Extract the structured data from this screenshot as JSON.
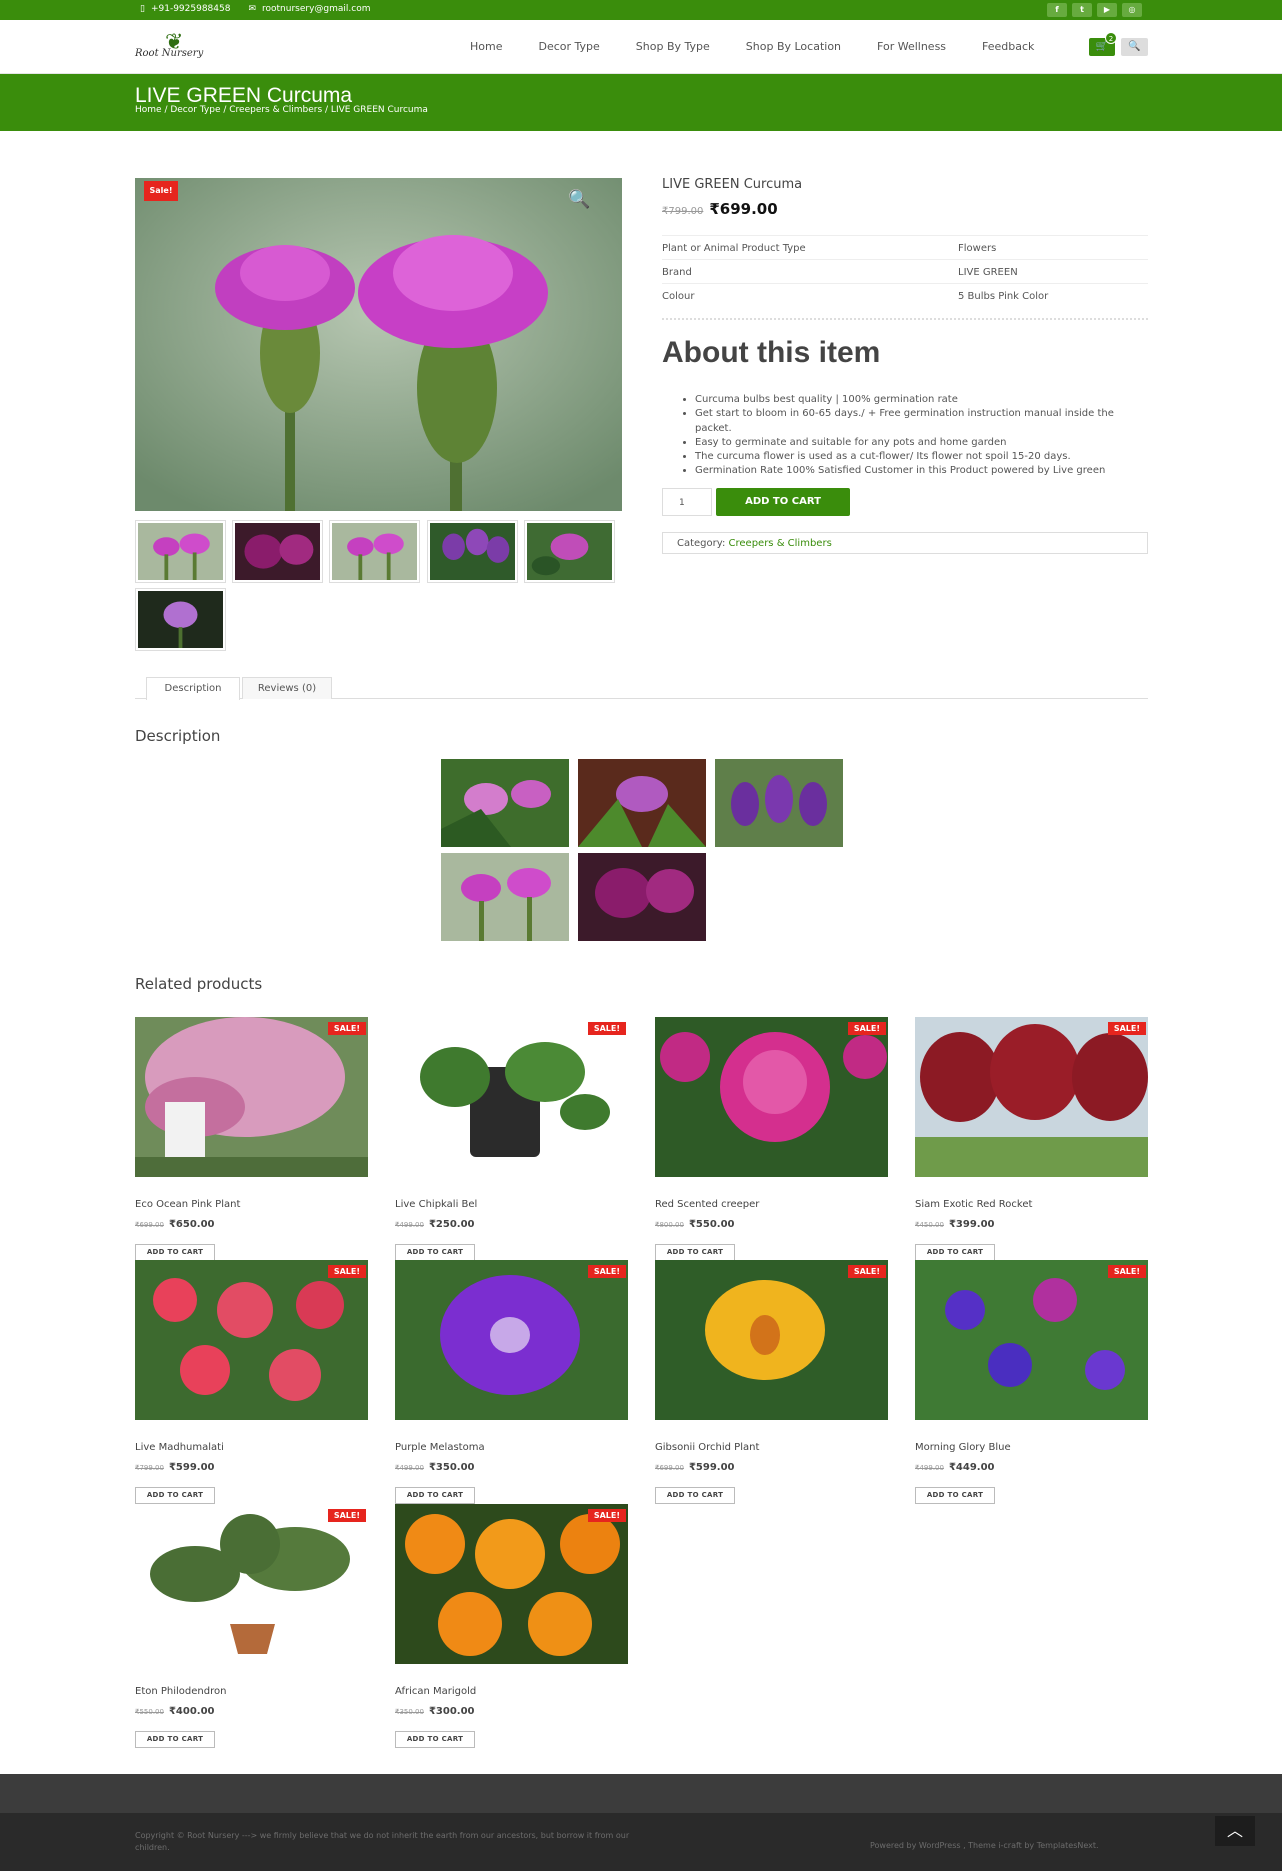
{
  "topbar": {
    "phone": "+91-9925988458",
    "email": "rootnursery@gmail.com",
    "phone_icon": "phone-icon",
    "email_icon": "mail-icon",
    "socials": [
      "facebook-icon",
      "twitter-icon",
      "youtube-icon",
      "instagram-icon"
    ]
  },
  "header": {
    "logo_text": "Root Nursery",
    "nav": [
      "Home",
      "Decor Type",
      "Shop By Type",
      "Shop By Location",
      "For Wellness",
      "Feedback"
    ],
    "cart_count": "2",
    "cart_icon": "cart-icon",
    "search_icon": "search-icon"
  },
  "titlebar": {
    "title": "LIVE GREEN Curcuma",
    "breadcrumb": "Home / Decor Type / Creepers & Climbers / LIVE GREEN Curcuma"
  },
  "product": {
    "sale_badge": "Sale!",
    "zoom_icon": "zoom-icon",
    "title": "LIVE GREEN Curcuma",
    "old_price": "₹799.00",
    "new_price": "₹699.00",
    "attributes": [
      {
        "key": "Plant or Animal Product Type",
        "value": "Flowers"
      },
      {
        "key": "Brand",
        "value": "LIVE GREEN"
      },
      {
        "key": "Colour",
        "value": "5 Bulbs Pink Color"
      }
    ],
    "about_heading": "About this item",
    "bullets": [
      "Curcuma bulbs best quality | 100% germination rate",
      "Get start to bloom in 60-65 days./ + Free germination instruction manual inside the packet.",
      "Easy to germinate and suitable for any pots and home garden",
      "The curcuma flower is used as a cut-flower/ Its flower not spoil 15-20 days.",
      "Germination Rate 100% Satisfied Customer in this Product powered by Live green"
    ],
    "quantity": "1",
    "add_to_cart": "ADD TO CART",
    "category_label": "Category:",
    "category_value": "Creepers & Climbers"
  },
  "tabs": [
    "Description",
    "Reviews (0)"
  ],
  "description_heading": "Description",
  "related": {
    "heading": "Related products",
    "sale_label": "SALE!",
    "button_label": "ADD TO CART",
    "items": [
      {
        "name": "Eco Ocean Pink Plant",
        "old": "₹699.00",
        "new": "₹650.00"
      },
      {
        "name": "Live Chipkali Bel",
        "old": "₹499.00",
        "new": "₹250.00"
      },
      {
        "name": "Red Scented creeper",
        "old": "₹800.00",
        "new": "₹550.00"
      },
      {
        "name": "Siam Exotic Red Rocket",
        "old": "₹450.00",
        "new": "₹399.00"
      },
      {
        "name": "Live Madhumalati",
        "old": "₹799.00",
        "new": "₹599.00"
      },
      {
        "name": "Purple Melastoma",
        "old": "₹499.00",
        "new": "₹350.00"
      },
      {
        "name": "Gibsonii Orchid Plant",
        "old": "₹699.00",
        "new": "₹599.00"
      },
      {
        "name": "Morning Glory Blue",
        "old": "₹499.00",
        "new": "₹449.00"
      },
      {
        "name": "Eton Philodendron",
        "old": "₹550.00",
        "new": "₹400.00"
      },
      {
        "name": "African Marigold",
        "old": "₹350.00",
        "new": "₹300.00"
      }
    ]
  },
  "footer": {
    "copyright": "Copyright © Root Nursery ---> we firmly believe that we do not inherit the earth from our ancestors, but borrow it from our children.",
    "powered": "Powered by WordPress , Theme i-craft by TemplatesNext.",
    "to_top_icon": "chevron-up-icon"
  },
  "colors": {
    "brand_green": "#3a8d0c",
    "sale_red": "#e6251e",
    "footer_dark": "#2a2a2a"
  }
}
